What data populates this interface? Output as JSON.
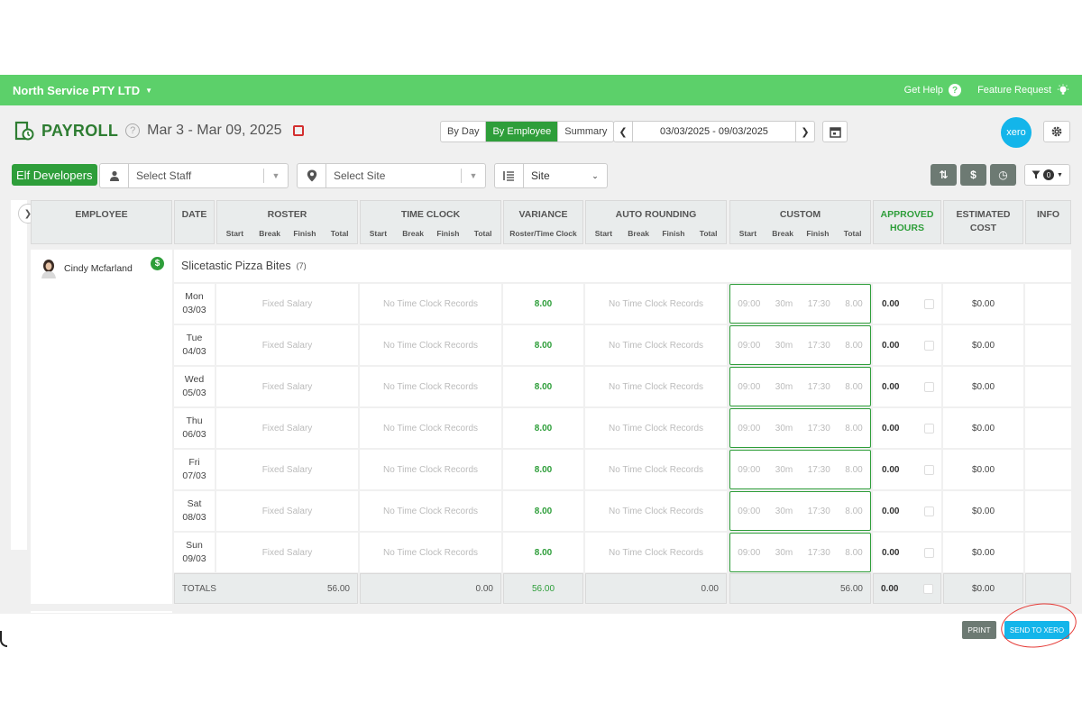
{
  "topbar": {
    "company": "North Service PTY LTD",
    "get_help": "Get Help",
    "feature_request": "Feature Request"
  },
  "header": {
    "title": "PAYROLL",
    "period": "Mar 3 - Mar 09, 2025",
    "views": [
      "By Day",
      "By Employee",
      "Summary"
    ],
    "active_view": "By Employee",
    "date_range": "03/03/2025 - 09/03/2025",
    "xero_label": "xero"
  },
  "filters": {
    "team": "Elf Developers",
    "staff_placeholder": "Select Staff",
    "site_placeholder": "Select Site",
    "group_by": "Site",
    "filter_count": "0"
  },
  "columns": {
    "employee": "EMPLOYEE",
    "date": "DATE",
    "roster": "ROSTER",
    "time_clock": "TIME CLOCK",
    "variance": "VARIANCE",
    "variance_sub": "Roster/Time Clock",
    "auto_rounding": "AUTO ROUNDING",
    "custom": "CUSTOM",
    "approved_hours": "APPROVED HOURS",
    "estimated_cost": "ESTIMATED COST",
    "info": "INFO",
    "sub": {
      "start": "Start",
      "break": "Break",
      "finish": "Finish",
      "total": "Total"
    }
  },
  "employee": {
    "name": "Cindy Mcfarland",
    "badge": "$"
  },
  "site": {
    "name": "Slicetastic Pizza Bites",
    "count": "(7)"
  },
  "rows": [
    {
      "day": "Mon",
      "date": "03/03",
      "roster": "Fixed Salary",
      "time_clock": "No Time Clock Records",
      "variance": "8.00",
      "auto_rounding": "No Time Clock Records",
      "c_start": "09:00",
      "c_break": "30m",
      "c_finish": "17:30",
      "c_total": "8.00",
      "approved": "0.00",
      "cost": "$0.00"
    },
    {
      "day": "Tue",
      "date": "04/03",
      "roster": "Fixed Salary",
      "time_clock": "No Time Clock Records",
      "variance": "8.00",
      "auto_rounding": "No Time Clock Records",
      "c_start": "09:00",
      "c_break": "30m",
      "c_finish": "17:30",
      "c_total": "8.00",
      "approved": "0.00",
      "cost": "$0.00"
    },
    {
      "day": "Wed",
      "date": "05/03",
      "roster": "Fixed Salary",
      "time_clock": "No Time Clock Records",
      "variance": "8.00",
      "auto_rounding": "No Time Clock Records",
      "c_start": "09:00",
      "c_break": "30m",
      "c_finish": "17:30",
      "c_total": "8.00",
      "approved": "0.00",
      "cost": "$0.00"
    },
    {
      "day": "Thu",
      "date": "06/03",
      "roster": "Fixed Salary",
      "time_clock": "No Time Clock Records",
      "variance": "8.00",
      "auto_rounding": "No Time Clock Records",
      "c_start": "09:00",
      "c_break": "30m",
      "c_finish": "17:30",
      "c_total": "8.00",
      "approved": "0.00",
      "cost": "$0.00"
    },
    {
      "day": "Fri",
      "date": "07/03",
      "roster": "Fixed Salary",
      "time_clock": "No Time Clock Records",
      "variance": "8.00",
      "auto_rounding": "No Time Clock Records",
      "c_start": "09:00",
      "c_break": "30m",
      "c_finish": "17:30",
      "c_total": "8.00",
      "approved": "0.00",
      "cost": "$0.00"
    },
    {
      "day": "Sat",
      "date": "08/03",
      "roster": "Fixed Salary",
      "time_clock": "No Time Clock Records",
      "variance": "8.00",
      "auto_rounding": "No Time Clock Records",
      "c_start": "09:00",
      "c_break": "30m",
      "c_finish": "17:30",
      "c_total": "8.00",
      "approved": "0.00",
      "cost": "$0.00"
    },
    {
      "day": "Sun",
      "date": "09/03",
      "roster": "Fixed Salary",
      "time_clock": "No Time Clock Records",
      "variance": "8.00",
      "auto_rounding": "No Time Clock Records",
      "c_start": "09:00",
      "c_break": "30m",
      "c_finish": "17:30",
      "c_total": "8.00",
      "approved": "0.00",
      "cost": "$0.00"
    }
  ],
  "totals": {
    "label": "TOTALS",
    "roster": "56.00",
    "time_clock": "0.00",
    "variance": "56.00",
    "auto_rounding": "0.00",
    "custom": "56.00",
    "approved": "0.00",
    "cost": "$0.00"
  },
  "footer": {
    "print": "PRINT",
    "send_to_xero": "SEND TO XERO"
  },
  "colors": {
    "brand_green": "#5cd06a",
    "dark_green": "#2e9e3a",
    "xero_blue": "#13b5ea",
    "annotation_red": "#e53935"
  }
}
